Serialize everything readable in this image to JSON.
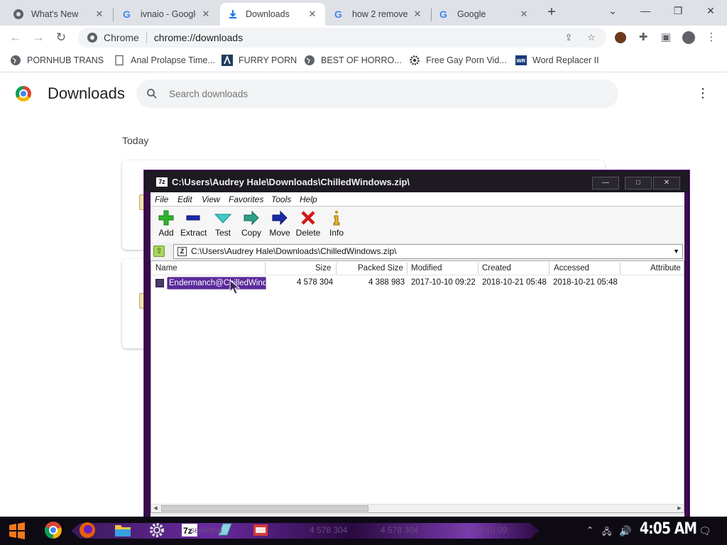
{
  "browser": {
    "tabs": [
      {
        "title": "What's New",
        "icon": "chrome-icon"
      },
      {
        "title": "ivnaio - Google",
        "icon": "google-icon"
      },
      {
        "title": "Downloads",
        "icon": "download-icon"
      },
      {
        "title": "how 2 remove",
        "icon": "google-icon"
      },
      {
        "title": "Google",
        "icon": "google-icon"
      }
    ],
    "omnibox": {
      "scheme": "Chrome",
      "url": "chrome://downloads"
    },
    "bookmarks": [
      {
        "label": "PORNHUB TRANS",
        "icon": "globe-icon"
      },
      {
        "label": "Anal Prolapse Time...",
        "icon": "page-icon"
      },
      {
        "label": "FURRY PORN",
        "icon": "a-logo-icon"
      },
      {
        "label": "BEST OF HORRO...",
        "icon": "globe-icon"
      },
      {
        "label": "Free Gay Porn Vid...",
        "icon": "gear-icon"
      },
      {
        "label": "Word Replacer II",
        "icon": "wr-icon"
      }
    ]
  },
  "downloads": {
    "title": "Downloads",
    "search_placeholder": "Search downloads",
    "section": "Today"
  },
  "sevenzip": {
    "title": "C:\\Users\\Audrey Hale\\Downloads\\ChilledWindows.zip\\",
    "menu": [
      "File",
      "Edit",
      "View",
      "Favorites",
      "Tools",
      "Help"
    ],
    "toolbar": [
      "Add",
      "Extract",
      "Test",
      "Copy",
      "Move",
      "Delete",
      "Info"
    ],
    "path": "C:\\Users\\Audrey Hale\\Downloads\\ChilledWindows.zip\\",
    "columns": [
      "Name",
      "Size",
      "Packed Size",
      "Modified",
      "Created",
      "Accessed",
      "Attribute"
    ],
    "rows": [
      {
        "name": "Endermanch@ChilledWind...",
        "size": "4 578 304",
        "packed": "4 388 983",
        "modified": "2017-10-10 09:22",
        "created": "2018-10-21 05:48",
        "accessed": "2018-10-21 05:48"
      }
    ]
  },
  "taskbar": {
    "ghost": {
      "selected": "selected",
      "size": "4 578 304",
      "packed": "4 578 304",
      "modified": "2017-10-10 09:"
    },
    "clock": "4:05 AM"
  },
  "colors": {
    "accent": "#6b26a0",
    "chrome_blue": "#1a73e8",
    "selection": "#5b2a9c"
  }
}
